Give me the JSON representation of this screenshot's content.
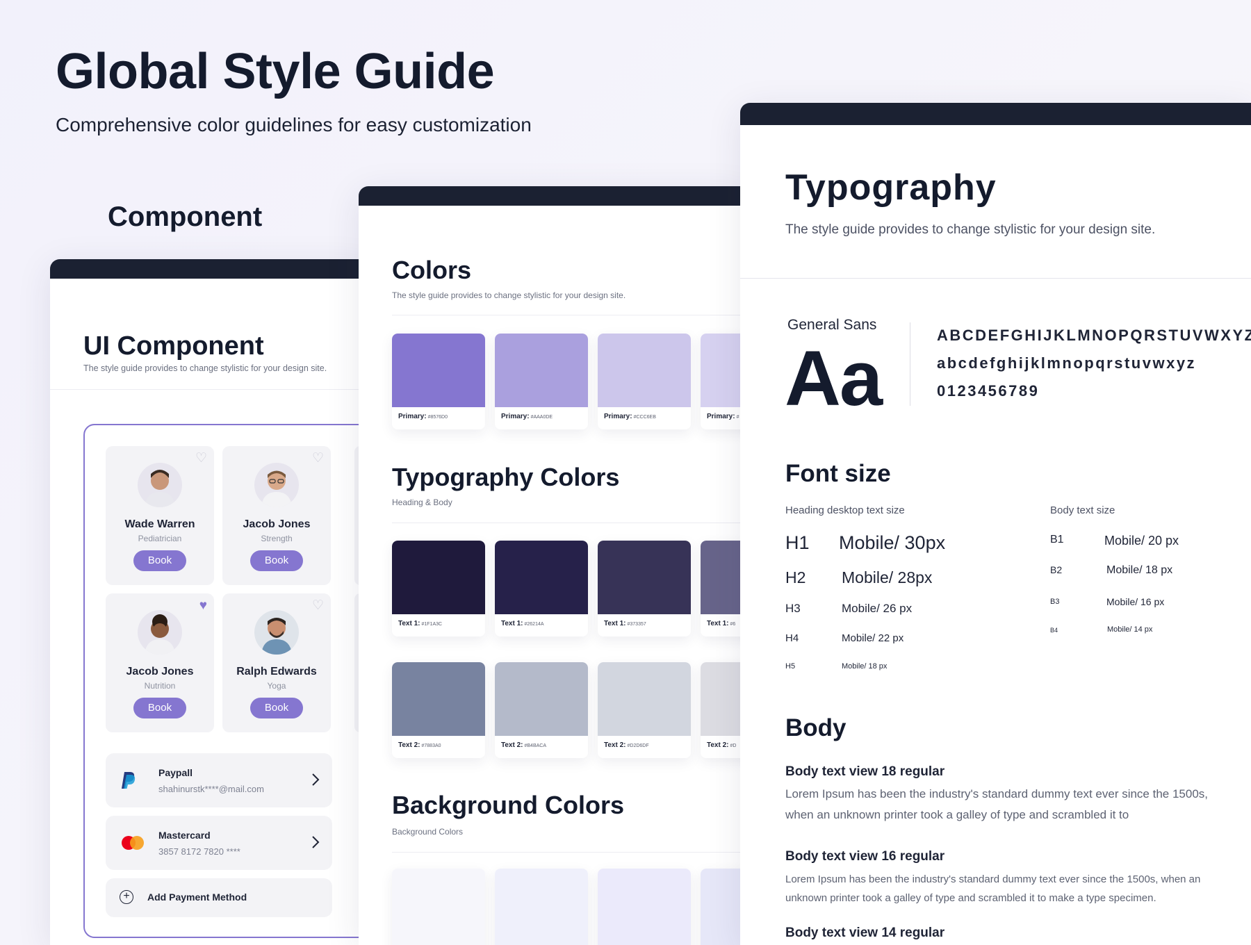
{
  "hero": {
    "title": "Global Style Guide",
    "subtitle": "Comprehensive color guidelines for easy customization",
    "component_label": "Component"
  },
  "component_panel": {
    "title": "UI Component",
    "subtitle": "The style guide provides to change stylistic for your design site.",
    "doctors": [
      {
        "name": "Wade Warren",
        "role": "Pediatrician",
        "button": "Book",
        "favorited": false
      },
      {
        "name": "Jacob Jones",
        "role": "Strength",
        "button": "Book",
        "favorited": false
      },
      {
        "name": "Jacob Jones",
        "role": "Nutrition",
        "button": "Book",
        "favorited": true
      },
      {
        "name": "Ralph Edwards",
        "role": "Yoga",
        "button": "Book",
        "favorited": false
      }
    ],
    "payments": [
      {
        "name": "Paypall",
        "detail": "shahinurstk****@mail.com",
        "icon": "paypal-icon"
      },
      {
        "name": "Mastercard",
        "detail": "3857 8172 7820 ****",
        "icon": "mastercard-icon"
      }
    ],
    "add_payment": "Add Payment Method"
  },
  "colors_panel": {
    "colors": {
      "title": "Colors",
      "subtitle": "The style guide provides to change stylistic for your design site."
    },
    "primary_swatches": [
      {
        "label": "Primary:",
        "hex": "#8576D0",
        "color": "#8576d0"
      },
      {
        "label": "Primary:",
        "hex": "#AAA0DE",
        "color": "#aaa0de"
      },
      {
        "label": "Primary:",
        "hex": "#CCC6EB",
        "color": "#ccc6eb"
      },
      {
        "label": "Primary:",
        "hex": "#",
        "color": "#d6d1f0"
      }
    ],
    "typography_colors": {
      "title": "Typography Colors",
      "subtitle": "Heading & Body"
    },
    "text1_swatches": [
      {
        "label": "Text 1:",
        "hex": "#1F1A3C",
        "color": "#1f1a3c"
      },
      {
        "label": "Text 1:",
        "hex": "#26214A",
        "color": "#26214a"
      },
      {
        "label": "Text 1:",
        "hex": "#373357",
        "color": "#373357"
      },
      {
        "label": "Text 1:",
        "hex": "#6",
        "color": "#67648a"
      }
    ],
    "text2_swatches": [
      {
        "label": "Text 2:",
        "hex": "#7883A0",
        "color": "#7883a0"
      },
      {
        "label": "Text 2:",
        "hex": "#B4BACA",
        "color": "#b4baca"
      },
      {
        "label": "Text 2:",
        "hex": "#D2D6DF",
        "color": "#d2d6df"
      },
      {
        "label": "Text 2:",
        "hex": "#D",
        "color": "#dcdce2"
      }
    ],
    "background_colors": {
      "title": "Background Colors",
      "subtitle": "Background Colors"
    },
    "bg_swatches": [
      {
        "color": "#f6f6fb"
      },
      {
        "color": "#eff0fb"
      },
      {
        "color": "#ebeafb"
      },
      {
        "color": "#e6e7f8"
      }
    ]
  },
  "typography_panel": {
    "title": "Typography",
    "subtitle": "The style guide provides to change stylistic for your design site.",
    "font_name": "General Sans",
    "font_sample": "Aa",
    "uppercase": "ABCDEFGHIJKLMNOPQRSTUVWXYZ",
    "lowercase": "abcdefghijklmnopqrstuvwxyz",
    "digits": "0123456789",
    "font_size_title": "Font size",
    "heading_label": "Heading desktop text size",
    "body_label": "Body text size",
    "headings": [
      {
        "tag": "H1",
        "value": "Mobile/ 30px"
      },
      {
        "tag": "H2",
        "value": "Mobile/ 28px"
      },
      {
        "tag": "H3",
        "value": "Mobile/ 26 px"
      },
      {
        "tag": "H4",
        "value": "Mobile/ 22 px"
      },
      {
        "tag": "H5",
        "value": "Mobile/ 18 px"
      }
    ],
    "body_sizes": [
      {
        "tag": "B1",
        "value": "Mobile/ 20 px"
      },
      {
        "tag": "B2",
        "value": "Mobile/ 18 px"
      },
      {
        "tag": "B3",
        "value": "Mobile/ 16 px"
      },
      {
        "tag": "B4",
        "value": "Mobile/ 14 px"
      }
    ],
    "body_title": "Body",
    "body_examples": [
      {
        "heading": "Body text view 18 regular",
        "text": "Lorem Ipsum has been the industry's standard dummy text ever since the 1500s, when an unknown printer took a galley of  type and scrambled it to"
      },
      {
        "heading": "Body text view 16 regular",
        "text": "Lorem Ipsum has been the industry's standard dummy text ever since the 1500s, when an unknown printer took a galley of  type and scrambled it to make a type specimen."
      },
      {
        "heading": "Body text view 14 regular",
        "text": ""
      }
    ]
  }
}
